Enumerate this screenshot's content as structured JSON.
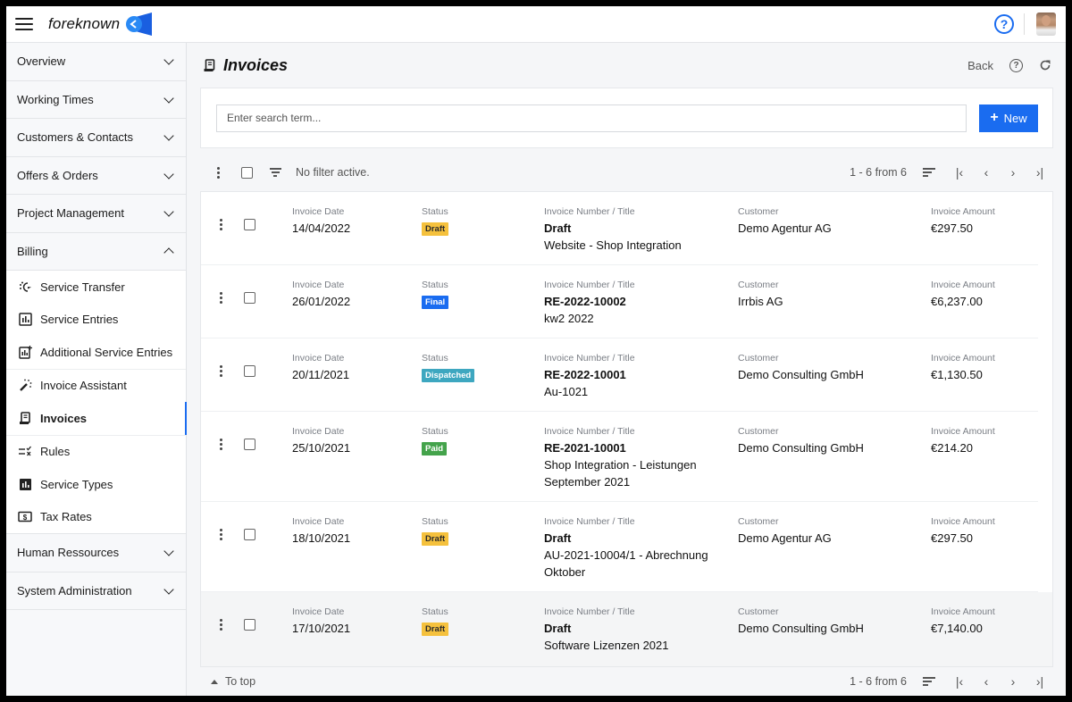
{
  "app": {
    "brand": "foreknown",
    "colors": {
      "accent": "#1a6cf0",
      "draft": "#f5c13d",
      "final": "#1a6cf0",
      "dispatched": "#3ea7c0",
      "paid": "#44a34b"
    }
  },
  "topbar": {
    "help_label": "?"
  },
  "sidebar": {
    "groups_top": [
      {
        "label": "Overview",
        "expanded": false
      },
      {
        "label": "Working Times",
        "expanded": false
      },
      {
        "label": "Customers & Contacts",
        "expanded": false
      },
      {
        "label": "Offers & Orders",
        "expanded": false
      },
      {
        "label": "Project Management",
        "expanded": false
      },
      {
        "label": "Billing",
        "expanded": true
      }
    ],
    "billing_items": [
      {
        "label": "Service Transfer",
        "icon": "service-transfer-icon"
      },
      {
        "label": "Service Entries",
        "icon": "chart-box-icon"
      },
      {
        "label": "Additional Service Entries",
        "icon": "chart-box-plus-icon"
      },
      {
        "label": "Invoice Assistant",
        "icon": "magic-wand-icon"
      },
      {
        "label": "Invoices",
        "icon": "receipt-icon",
        "active": true
      },
      {
        "label": "Rules",
        "icon": "rules-icon"
      },
      {
        "label": "Service Types",
        "icon": "chart-box-filled-icon"
      },
      {
        "label": "Tax Rates",
        "icon": "cash-icon"
      }
    ],
    "groups_bottom": [
      {
        "label": "Human Ressources",
        "expanded": false
      },
      {
        "label": "System Administration",
        "expanded": false
      }
    ]
  },
  "page": {
    "title": "Invoices",
    "back_label": "Back",
    "help_label": "?",
    "refresh_label": "↻"
  },
  "search": {
    "placeholder": "Enter search term...",
    "value": "",
    "new_label": "New",
    "new_icon": "+"
  },
  "toolbar": {
    "filter_text": "No filter active.",
    "range": "1 - 6 from 6",
    "first": "|‹",
    "prev": "‹",
    "next": "›",
    "last": "›|"
  },
  "columns": {
    "date": "Invoice Date",
    "status": "Status",
    "number": "Invoice Number / Title",
    "customer": "Customer",
    "amount": "Invoice Amount"
  },
  "invoices": [
    {
      "date": "14/04/2022",
      "status": "Draft",
      "status_key": "draft",
      "number": "Draft",
      "title": "Website - Shop Integration",
      "customer": "Demo Agentur AG",
      "amount": "€297.50"
    },
    {
      "date": "26/01/2022",
      "status": "Final",
      "status_key": "final",
      "number": "RE-2022-10002",
      "title": "kw2 2022",
      "customer": "Irrbis AG",
      "amount": "€6,237.00"
    },
    {
      "date": "20/11/2021",
      "status": "Dispatched",
      "status_key": "dispatched",
      "number": "RE-2022-10001",
      "title": "Au-1021",
      "customer": "Demo Consulting GmbH",
      "amount": "€1,130.50"
    },
    {
      "date": "25/10/2021",
      "status": "Paid",
      "status_key": "paid",
      "number": "RE-2021-10001",
      "title": "Shop Integration - Leistungen September 2021",
      "customer": "Demo Consulting GmbH",
      "amount": "€214.20"
    },
    {
      "date": "18/10/2021",
      "status": "Draft",
      "status_key": "draft",
      "number": "Draft",
      "title": "AU-2021-10004/1 - Abrechnung Oktober",
      "customer": "Demo Agentur AG",
      "amount": "€297.50"
    },
    {
      "date": "17/10/2021",
      "status": "Draft",
      "status_key": "draft",
      "number": "Draft",
      "title": "Software Lizenzen 2021",
      "customer": "Demo Consulting GmbH",
      "amount": "€7,140.00"
    }
  ],
  "footer": {
    "to_top_label": "To top",
    "range": "1 - 6 from 6"
  }
}
